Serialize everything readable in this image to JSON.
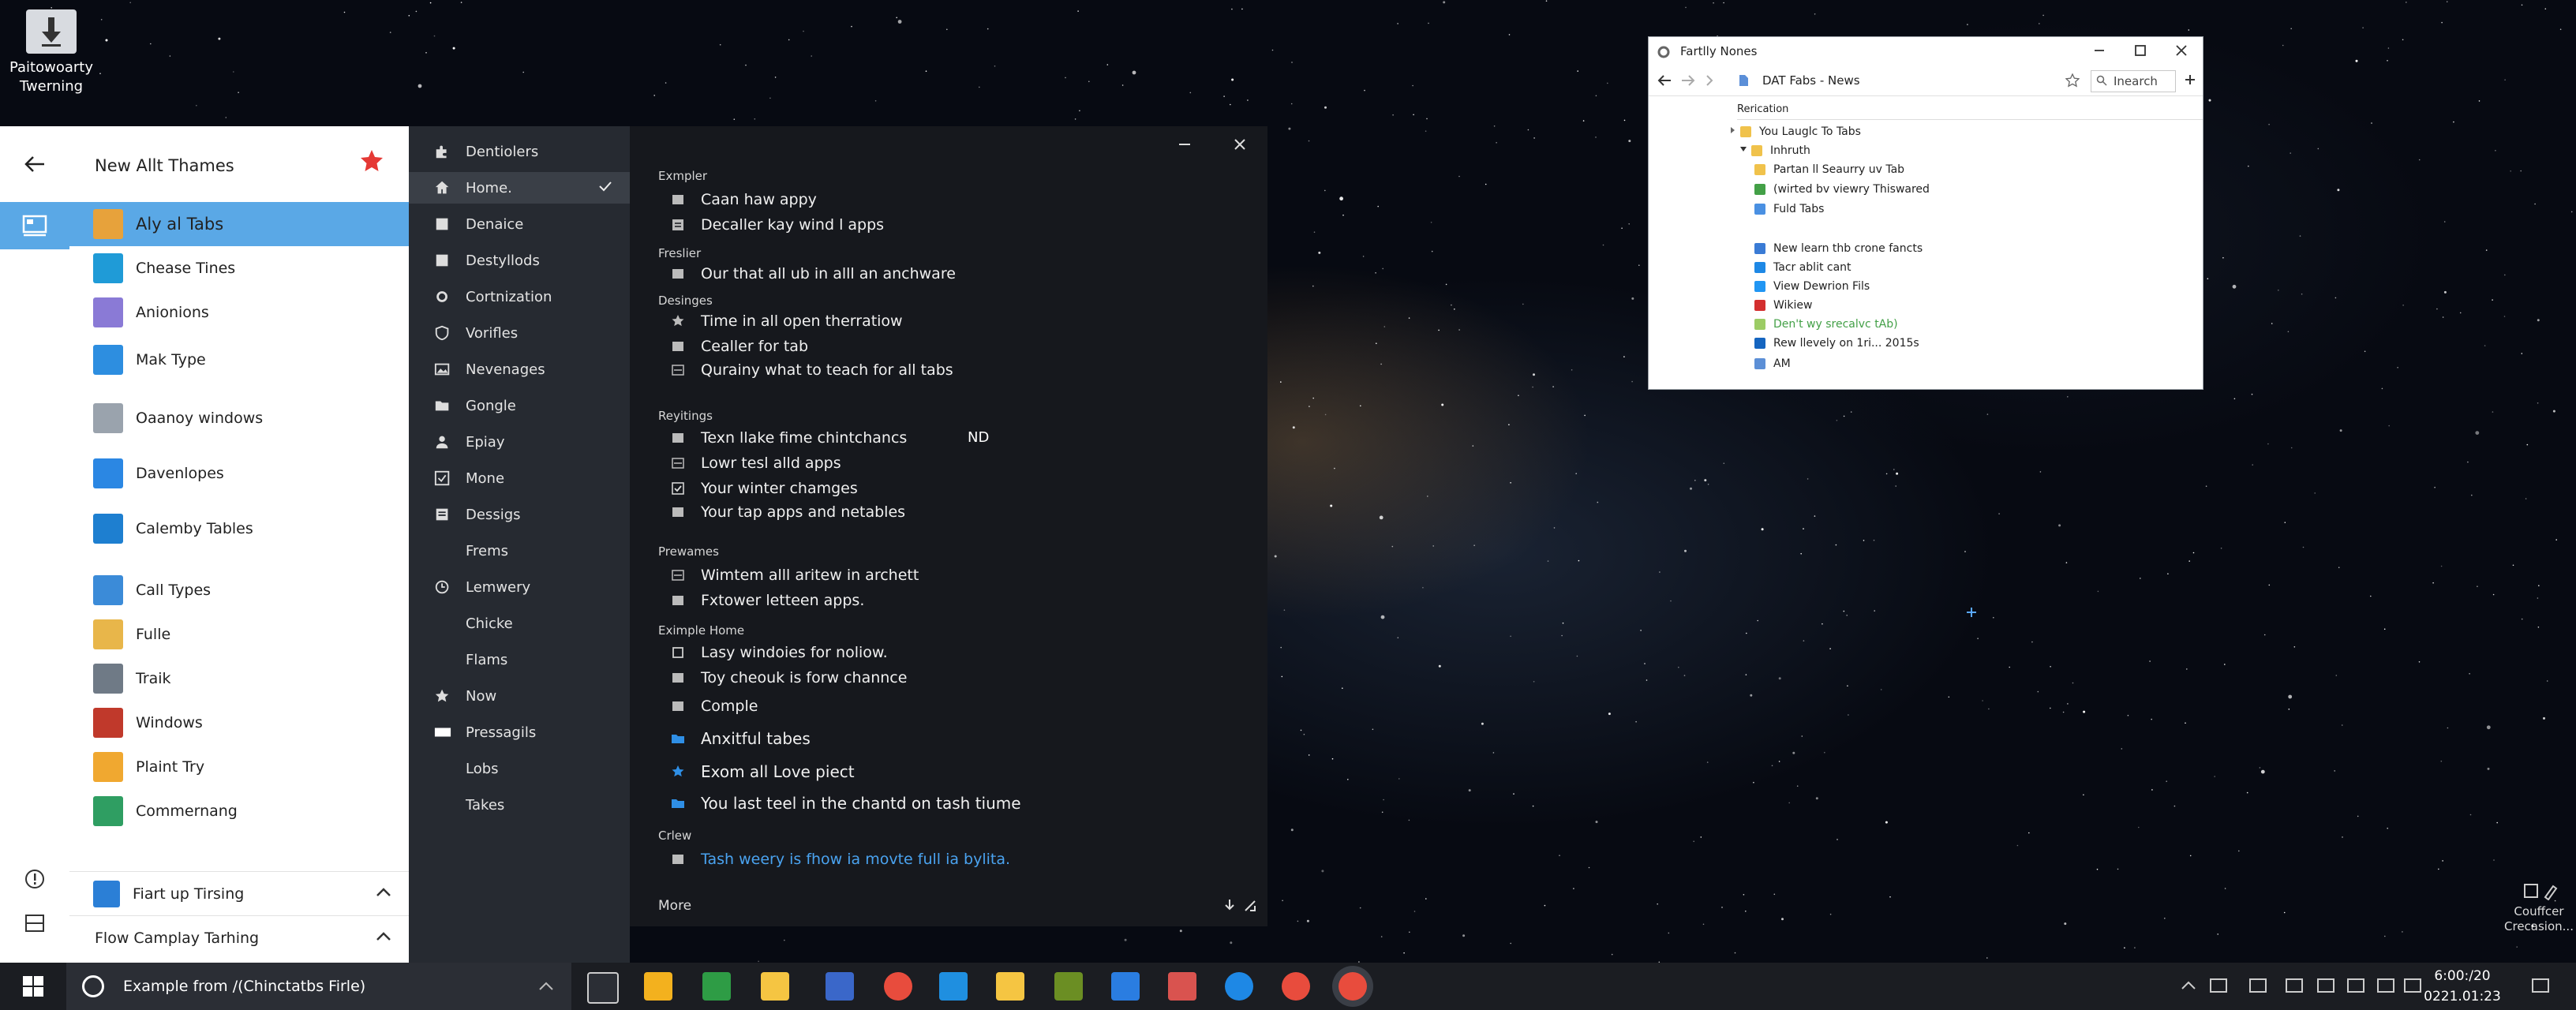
{
  "desktop": {
    "icon1_label_line1": "Paitowoarty",
    "icon1_label_line2": "Twerning",
    "icon2_label_line1": "Couffcer",
    "icon2_label_line2": "Crecasion..."
  },
  "start": {
    "header_title": "New  Allt Thames",
    "apps": [
      {
        "label": "Aly al Tabs",
        "color": "#e7a23b",
        "selected": true
      },
      {
        "label": "Chease Tines",
        "color": "#1f9bd7"
      },
      {
        "label": "Anionions",
        "color": "#8a7ad6"
      },
      {
        "label": "Mak Type",
        "color": "#2d8ee0"
      },
      {
        "label": "Oaanoy windows",
        "color": "#9aa3ad"
      },
      {
        "label": "Davenlopes",
        "color": "#2b87e3"
      },
      {
        "label": "Calemby Tables",
        "color": "#1e7fd0"
      },
      {
        "label": "Call Types",
        "color": "#3b8bd8"
      },
      {
        "label": "Fulle",
        "color": "#e8b64a"
      },
      {
        "label": "Traik",
        "color": "#6f7a86"
      },
      {
        "label": "Windows",
        "color": "#c0392b"
      },
      {
        "label": "Plaint Try",
        "color": "#f0a830"
      },
      {
        "label": "Commernang",
        "color": "#2f9e62"
      }
    ],
    "footer1_label": "Fiart up Tirsing",
    "footer2_label": "Flow  Camplay Tarhing"
  },
  "nav": {
    "items": [
      {
        "label": "Dentiolers",
        "icon": "puzzle-icon"
      },
      {
        "label": "Home.",
        "icon": "home-icon",
        "active": true
      },
      {
        "label": "Denaice",
        "icon": "square-icon"
      },
      {
        "label": "Destyllods",
        "icon": "square-icon"
      },
      {
        "label": "Cortnization",
        "icon": "gear-icon"
      },
      {
        "label": "Vorifles",
        "icon": "shield-icon"
      },
      {
        "label": "Nevenages",
        "icon": "image-icon"
      },
      {
        "label": "Gongle",
        "icon": "folder-icon"
      },
      {
        "label": "Epiay",
        "icon": "person-icon"
      },
      {
        "label": "Mone",
        "icon": "check-box-icon"
      },
      {
        "label": "Dessigs",
        "icon": "doc-icon"
      },
      {
        "label": "Frems",
        "icon": ""
      },
      {
        "label": "Lemwery",
        "icon": "clock-icon"
      },
      {
        "label": "Chicke",
        "icon": ""
      },
      {
        "label": "Flams",
        "icon": ""
      },
      {
        "label": "Now",
        "icon": "star-icon"
      },
      {
        "label": "Pressagils",
        "icon": "rect-icon"
      },
      {
        "label": "Lobs",
        "icon": ""
      },
      {
        "label": "Takes",
        "icon": ""
      }
    ]
  },
  "panel": {
    "sections": [
      {
        "head": "Exmpler",
        "options": [
          "Caan haw appy",
          "Decaller kay wind l apps"
        ]
      },
      {
        "head": "Freslier",
        "options": [
          "Our that all ub in alll an anchware"
        ]
      },
      {
        "head": "Desinges",
        "options": [
          "Time in all open therratiow",
          "Cealler for tab",
          "Qurainy what to teach for all tabs"
        ]
      },
      {
        "head": "Reyitings",
        "options": [
          "Texn llake fime chintchancs",
          "Lowr tesl alld apps",
          "Your winter chamges",
          "Your tap apps and netables"
        ]
      },
      {
        "head": "Prewames",
        "options": [
          "Wimtem alll aritew in archett",
          "Fxtower letteen apps."
        ]
      },
      {
        "head": "Eximple Home",
        "options": [
          "Lasy windoies for noliow.",
          "Toy cheouk is forw channce",
          "Comple",
          "Anxitful tabes",
          "Exom all Love piect",
          "You last teel in the chantd on tash tiume"
        ]
      },
      {
        "head": "Crlew",
        "options": [
          "Tash weery is fhow ia movte full ia bylita."
        ]
      }
    ],
    "nd_label": "ND",
    "more_label": "More"
  },
  "browser": {
    "title": "Fartlly  Nones",
    "url": "DAT Fabs -  News",
    "search_placeholder": "Inearch",
    "section_label": "Rerication",
    "tree_root": "You Lauglc To Tabs",
    "tree_folder": "Inhruth",
    "tree_items": [
      "Partan ll Seaurry uv Tab",
      "(wirted bv viewry Thiswared",
      "Fuld Tabs"
    ],
    "bookmarks": [
      {
        "label": "New learn thb crone fancts",
        "color": "#3a7bd5"
      },
      {
        "label": "Tacr ablit cant",
        "color": "#1e88e5"
      },
      {
        "label": "View Dewrion Fils",
        "color": "#2196f3"
      },
      {
        "label": "Wikiew",
        "color": "#d32f2f"
      },
      {
        "label": "Den't wy srecalvc tAb)",
        "color": "#9ccc65",
        "green": true
      },
      {
        "label": "Rew llevely on 1ri... 2015s",
        "color": "#1565c0"
      },
      {
        "label": "AM",
        "color": "#5c8fd6"
      }
    ]
  },
  "taskbar": {
    "search_text": "Example from /(Chinctatbs Firle)",
    "time": "6:00:/20",
    "date": "0221.01:23"
  }
}
